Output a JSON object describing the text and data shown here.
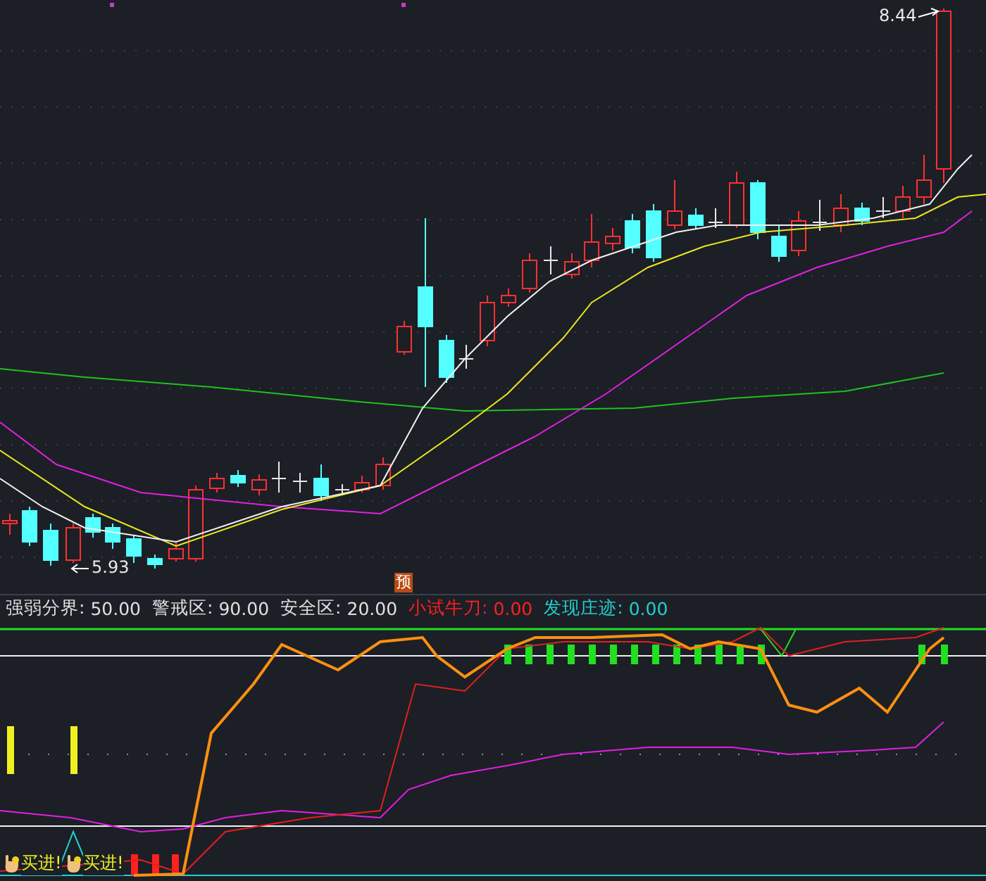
{
  "main_chart": {
    "high_label": "8.44",
    "low_label": "5.93",
    "marker": "预"
  },
  "indicator": {
    "legend": [
      {
        "label": "强弱分界:",
        "value": "50.00",
        "color": "#e0e0e0"
      },
      {
        "label": "警戒区:",
        "value": "90.00",
        "color": "#e0e0e0"
      },
      {
        "label": "安全区:",
        "value": "20.00",
        "color": "#e0e0e0"
      },
      {
        "label": "小试牛刀:",
        "value": "0.00",
        "color": "#ff2020"
      },
      {
        "label": "发现庄迹:",
        "value": "0.00",
        "color": "#20d0d0"
      }
    ],
    "signals": [
      {
        "text": "买进!"
      },
      {
        "text": "买进!"
      }
    ]
  }
}
